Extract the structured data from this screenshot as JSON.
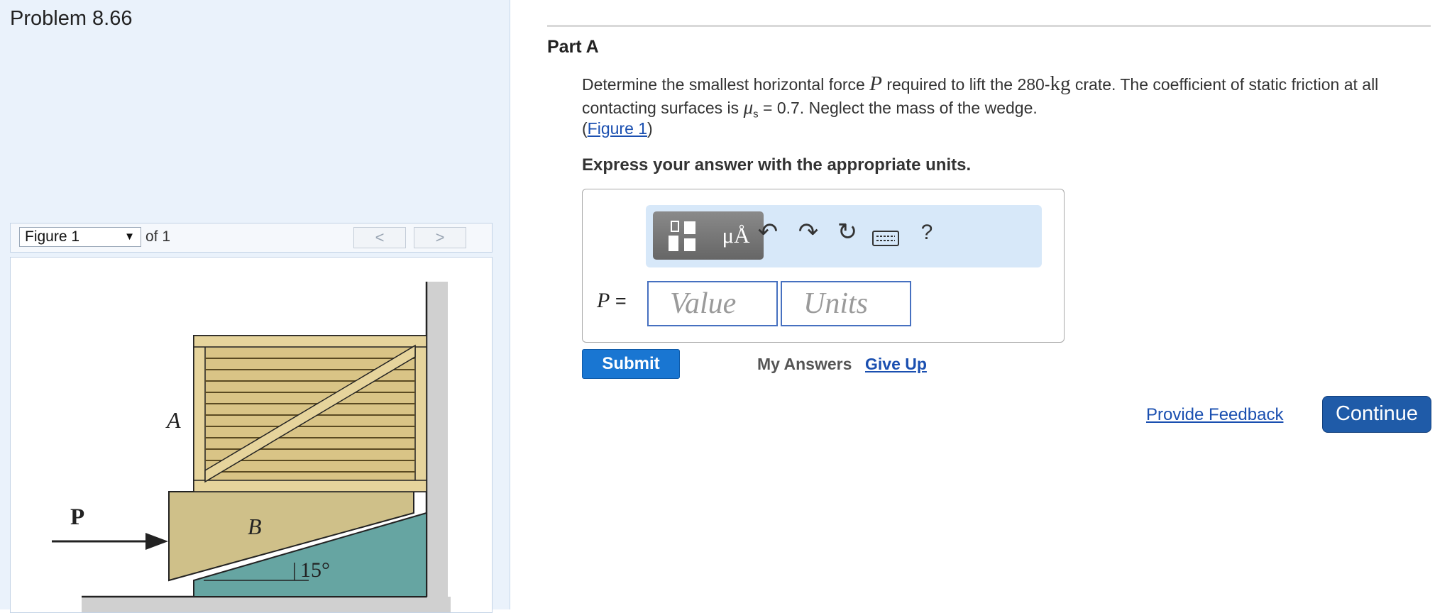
{
  "problem": {
    "title": "Problem 8.66"
  },
  "figure_nav": {
    "selected": "Figure 1",
    "of_text": "of 1",
    "prev_glyph": "<",
    "next_glyph": ">"
  },
  "figure": {
    "label_A": "A",
    "label_B": "B",
    "label_P": "P",
    "angle_label": "15°"
  },
  "part": {
    "title": "Part A",
    "question_1": "Determine the smallest horizontal force ",
    "var_P": "P",
    "question_2": " required to lift the 280-",
    "unit_kg": "kg",
    "question_3": " crate. The coefficient of static friction at all contacting surfaces is ",
    "mu": "μ",
    "mu_sub": "s",
    "question_4": " = 0.7. Neglect the mass of the wedge.",
    "fig_link_open": "(",
    "fig_link": "Figure 1",
    "fig_link_close": ")",
    "instruction": "Express your answer with the appropriate units."
  },
  "toolbar": {
    "units_symbol": "μÅ",
    "help": "?",
    "icons": [
      "templates-icon",
      "units-icon",
      "undo-icon",
      "redo-icon",
      "reset-icon",
      "keyboard-icon",
      "help-icon"
    ]
  },
  "answer": {
    "label_var": "P",
    "label_eq": " =",
    "value_placeholder": "Value",
    "units_placeholder": "Units"
  },
  "actions": {
    "submit": "Submit",
    "my_answers": "My Answers",
    "give_up": "Give Up",
    "feedback": "Provide Feedback",
    "continue": "Continue"
  },
  "colors": {
    "submit_blue": "#1976d2",
    "continue_blue": "#1f5ba8",
    "link_blue": "#1a4fb0",
    "toolbar_bg": "#d7e8f9",
    "crate_tan": "#d9c486",
    "wedge_khaki": "#cfc089",
    "incline_teal": "#66a5a2"
  }
}
